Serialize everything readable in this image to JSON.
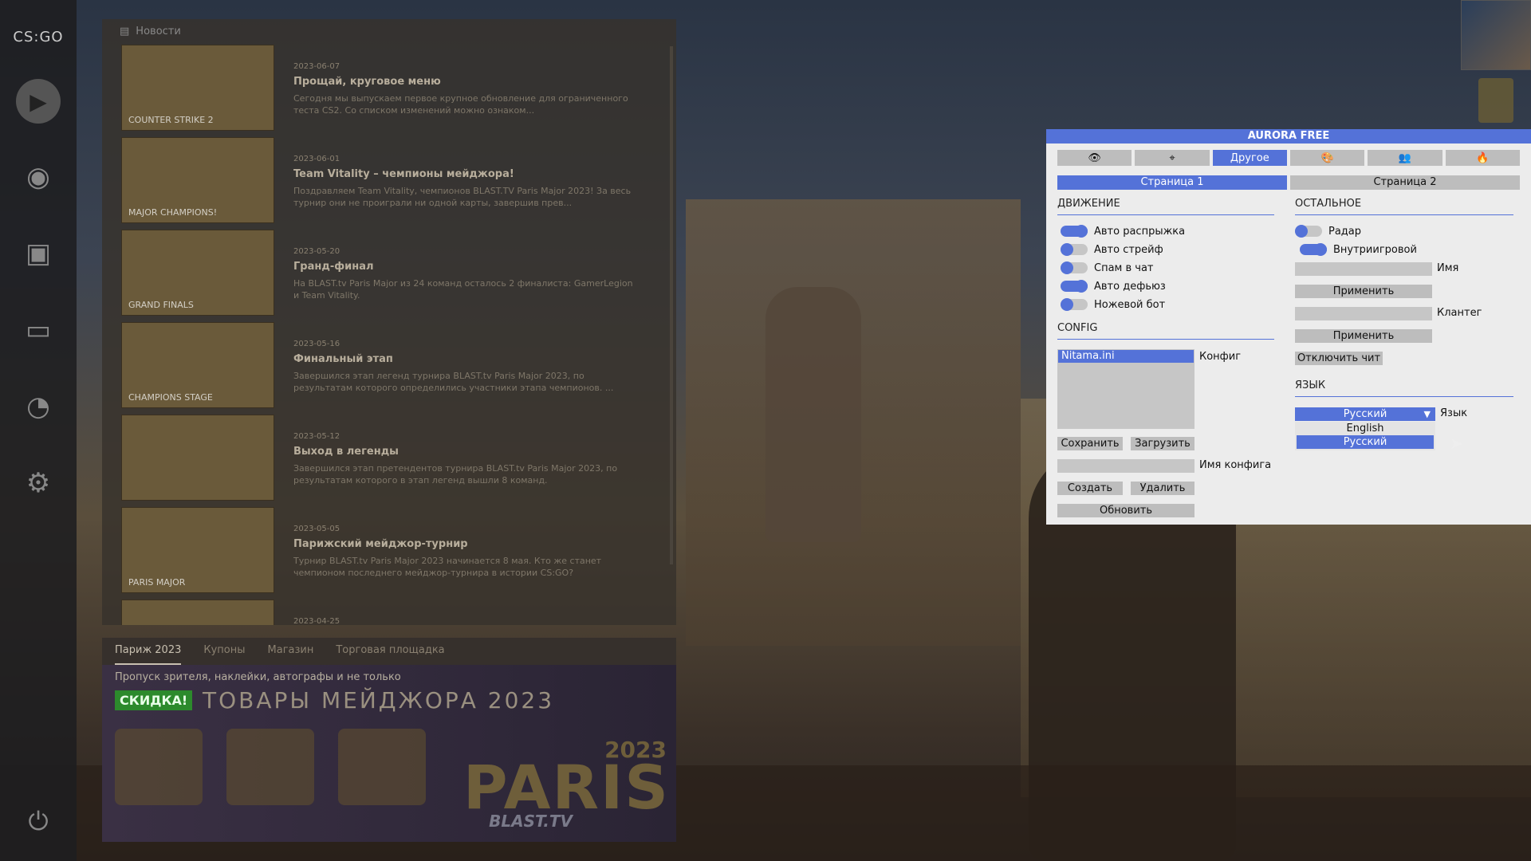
{
  "sidebar": {
    "logo": "CS:GO",
    "icons": [
      "play-icon",
      "broadcast-icon",
      "inventory-icon",
      "watch-icon",
      "stats-icon",
      "gear-icon",
      "power-icon"
    ]
  },
  "news": {
    "header": "Новости",
    "items": [
      {
        "thumb": "COUNTER STRIKE 2",
        "date": "2023-06-07",
        "title": "Прощай, круговое меню",
        "desc": "Сегодня мы выпускаем первое крупное обновление для ограниченного теста CS2. Со списком изменений можно ознаком..."
      },
      {
        "thumb": "MAJOR CHAMPIONS!",
        "date": "2023-06-01",
        "title": "Team Vitality – чемпионы мейджора!",
        "desc": "Поздравляем Team Vitality, чемпионов BLAST.TV Paris Major 2023! За весь турнир они не проиграли ни одной карты, завершив прев..."
      },
      {
        "thumb": "GRAND FINALS",
        "date": "2023-05-20",
        "title": "Гранд-финал",
        "desc": "На BLAST.tv Paris Major из 24 команд осталось 2 финалиста: GamerLegion и Team Vitality."
      },
      {
        "thumb": "CHAMPIONS STAGE",
        "date": "2023-05-16",
        "title": "Финальный этап",
        "desc": "Завершился этап легенд турнира BLAST.tv Paris Major 2023, по результатам которого определились участники этапа чемпионов. ..."
      },
      {
        "thumb": "",
        "date": "2023-05-12",
        "title": "Выход в легенды",
        "desc": "Завершился этап претендентов турнира BLAST.tv Paris Major 2023, по результатам которого в этап легенд вышли 8 команд."
      },
      {
        "thumb": "PARIS MAJOR",
        "date": "2023-05-05",
        "title": "Парижский мейджор-турнир",
        "desc": "Турнир BLAST.tv Paris Major 2023 начинается 8 мая. Кто же станет чемпионом последнего мейджор-турнира в истории CS:GO?"
      },
      {
        "thumb": "",
        "date": "2023-04-25",
        "title": "",
        "desc": ""
      }
    ]
  },
  "store": {
    "tabs": [
      "Париж 2023",
      "Купоны",
      "Магазин",
      "Торговая площадка"
    ],
    "subtitle": "Пропуск зрителя, наклейки, автографы и не только",
    "sale_badge": "СКИДКА!",
    "title": "ТОВАРЫ МЕЙДЖОРА 2023",
    "logo": "PARIS",
    "year": "2023",
    "blast": "BLAST.TV"
  },
  "aurora": {
    "title": "AURORA FREE",
    "tabs": [
      {
        "icon": "eye-icon",
        "label": "👁"
      },
      {
        "icon": "crosshair-icon",
        "label": "⌖"
      },
      {
        "icon": "other-tab",
        "label": "Другое"
      },
      {
        "icon": "palette-icon",
        "label": "🎨"
      },
      {
        "icon": "users-icon",
        "label": "👥"
      },
      {
        "icon": "fire-icon",
        "label": "🔥"
      }
    ],
    "pages": [
      "Страница 1",
      "Страница 2"
    ],
    "movement": {
      "header": "ДВИЖЕНИЕ",
      "toggles": [
        {
          "label": "Авто распрыжка",
          "on": true
        },
        {
          "label": "Авто стрейф",
          "on": false
        },
        {
          "label": "Спам в чат",
          "on": false
        },
        {
          "label": "Авто дефьюз",
          "on": true
        },
        {
          "label": "Ножевой бот",
          "on": false
        }
      ]
    },
    "other": {
      "header": "ОСТАЛЬНОЕ",
      "toggles": [
        {
          "label": "Радар",
          "on": false
        },
        {
          "label": "Внутриигровой",
          "on": true
        }
      ],
      "name_label": "Имя",
      "apply1": "Применить",
      "clantag_label": "Клантег",
      "apply2": "Применить",
      "disable": "Отключить чит"
    },
    "config": {
      "header": "CONFIG",
      "selected": "Nitama.ini",
      "list_label": "Конфиг",
      "save": "Сохранить",
      "load": "Загрузить",
      "name_label": "Имя конфига",
      "create": "Создать",
      "delete": "Удалить",
      "refresh": "Обновить"
    },
    "language": {
      "header": "ЯЗЫК",
      "selected": "Русский",
      "label": "Язык",
      "options": [
        "English",
        "Русский"
      ]
    },
    "accent": "#5472d8"
  }
}
